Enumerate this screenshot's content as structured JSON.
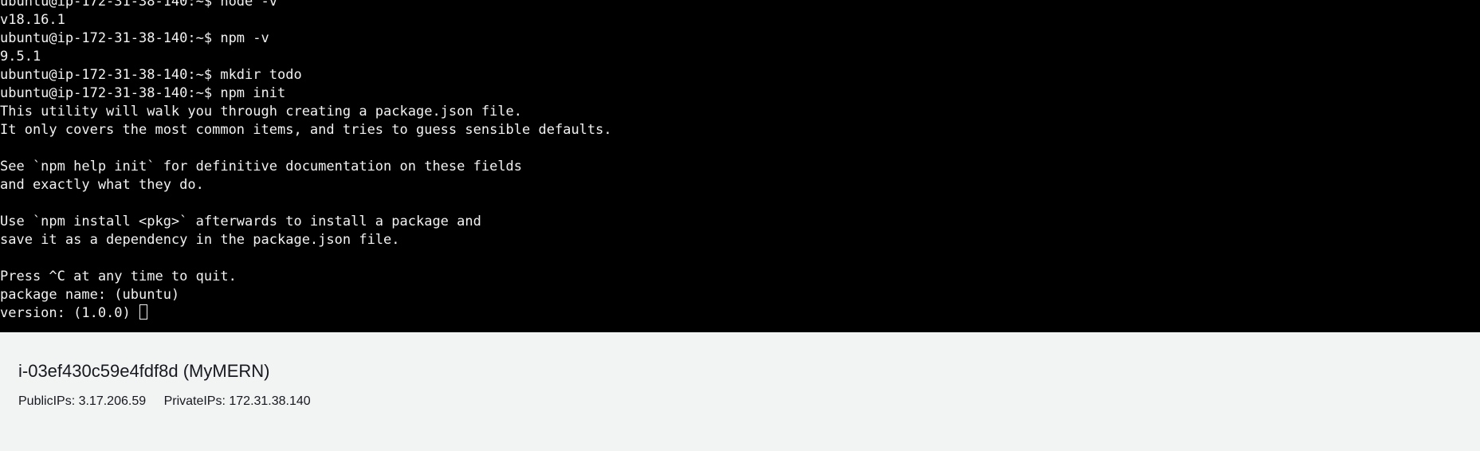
{
  "terminal": {
    "lines": [
      "ubuntu@ip-172-31-38-140:~$ node -v",
      "v18.16.1",
      "ubuntu@ip-172-31-38-140:~$ npm -v",
      "9.5.1",
      "ubuntu@ip-172-31-38-140:~$ mkdir todo",
      "ubuntu@ip-172-31-38-140:~$ npm init",
      "This utility will walk you through creating a package.json file.",
      "It only covers the most common items, and tries to guess sensible defaults.",
      "",
      "See `npm help init` for definitive documentation on these fields",
      "and exactly what they do.",
      "",
      "Use `npm install <pkg>` afterwards to install a package and",
      "save it as a dependency in the package.json file.",
      "",
      "Press ^C at any time to quit.",
      "package name: (ubuntu)"
    ],
    "current_prompt": "version: (1.0.0) ",
    "colors": {
      "background": "#000000",
      "foreground": "#f2f2f2"
    }
  },
  "instance": {
    "title": "i-03ef430c59e4fdf8d (MyMERN)",
    "public_ips": "PublicIPs: 3.17.206.59",
    "private_ips": "PrivateIPs: 172.31.38.140",
    "colors": {
      "panel_background": "#f2f3f3",
      "text": "#16191f"
    }
  }
}
